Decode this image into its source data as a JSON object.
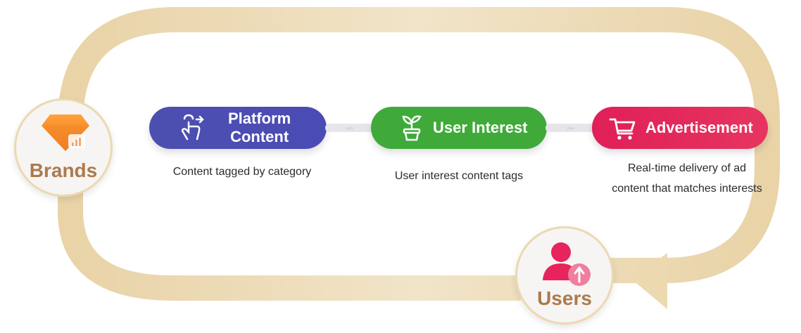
{
  "nodes": {
    "brands": {
      "label": "Brands"
    },
    "users": {
      "label": "Users"
    }
  },
  "steps": [
    {
      "label_line1": "Platform",
      "label_line2": "Content",
      "description": "Content tagged by category",
      "icon": "tap-gesture-icon",
      "color": "#4b4db3"
    },
    {
      "label": "User Interest",
      "description": "User interest content tags",
      "icon": "sprout-pot-icon",
      "color": "#3faa3a"
    },
    {
      "label": "Advertisement",
      "description_line1": "Real-time delivery of ad",
      "description_line2": "content that matches interests",
      "icon": "shopping-cart-icon",
      "color": "#e3265a"
    }
  ],
  "connector_glyphs": "›››››",
  "loop_color": "#ecd9b0"
}
